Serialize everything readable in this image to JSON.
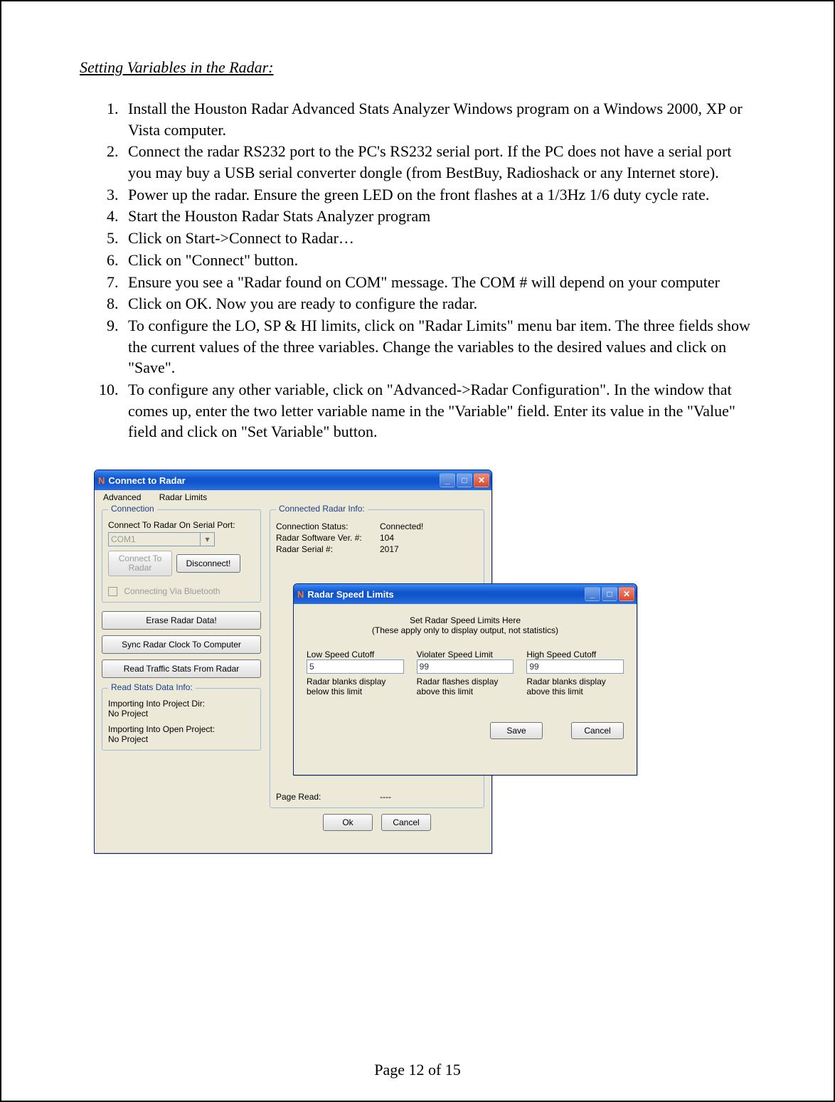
{
  "section_title": "Setting Variables in the Radar:",
  "steps": [
    "Install the Houston Radar Advanced Stats Analyzer Windows program on a Windows 2000, XP or Vista computer.",
    "Connect the radar RS232 port to the PC's RS232 serial port. If the PC does not have a serial port you may buy a USB serial converter dongle (from BestBuy, Radioshack or any Internet store).",
    "Power up the radar. Ensure the green LED on the front flashes at a 1/3Hz 1/6 duty cycle rate.",
    "Start the Houston Radar Stats Analyzer program",
    "Click on Start->Connect to Radar…",
    "Click on \"Connect\" button.",
    "Ensure you see a \"Radar found on COM\" message. The COM # will depend on your computer",
    "Click on OK. Now you are ready to configure the radar.",
    "To configure the LO, SP & HI limits, click on \"Radar Limits\" menu bar item. The three fields show the current values of the three variables. Change the variables to the desired values and click on \"Save\".",
    "To configure any other variable, click on \"Advanced->Radar Configuration\". In the window that comes up, enter the two letter variable name in the \"Variable\" field. Enter its value in the \"Value\" field and click on \"Set Variable\" button."
  ],
  "footer": "Page 12 of 15",
  "connect_window": {
    "title": "Connect to Radar",
    "menu": {
      "advanced": "Advanced",
      "radar_limits": "Radar Limits"
    },
    "groups": {
      "connection": {
        "legend": "Connection",
        "serial_label": "Connect To Radar On Serial Port:",
        "serial_value": "COM1",
        "connect_btn": "Connect To Radar",
        "disconnect_btn": "Disconnect!",
        "bluetooth": "Connecting Via Bluetooth"
      },
      "buttons": {
        "erase": "Erase Radar Data!",
        "sync": "Sync Radar Clock To Computer",
        "read": "Read Traffic Stats From Radar"
      },
      "read_stats": {
        "legend": "Read Stats Data Info:",
        "import_dir_lbl": "Importing Into Project Dir:",
        "import_dir_val": "No Project",
        "import_open_lbl": "Importing Into Open Project:",
        "import_open_val": "No Project"
      },
      "radar_info": {
        "legend": "Connected Radar Info:",
        "status_lbl": "Connection Status:",
        "status_val": "Connected!",
        "sw_lbl": "Radar Software Ver. #:",
        "sw_val": "104",
        "serial_lbl": "Radar Serial #:",
        "serial_val": "2017",
        "page_read_lbl": "Page Read:",
        "page_read_val": "----"
      }
    },
    "ok_btn": "Ok",
    "cancel_btn": "Cancel"
  },
  "limits_window": {
    "title": "Radar Speed Limits",
    "heading": "Set Radar Speed Limits Here",
    "subheading": "(These apply only to display output, not statistics)",
    "cols": [
      {
        "label": "Low Speed Cutoff",
        "value": "5",
        "note": "Radar blanks display below this limit"
      },
      {
        "label": "Violater Speed Limit",
        "value": "99",
        "note": "Radar flashes display above this limit"
      },
      {
        "label": "High Speed Cutoff",
        "value": "99",
        "note": "Radar blanks display above this limit"
      }
    ],
    "save": "Save",
    "cancel": "Cancel"
  }
}
